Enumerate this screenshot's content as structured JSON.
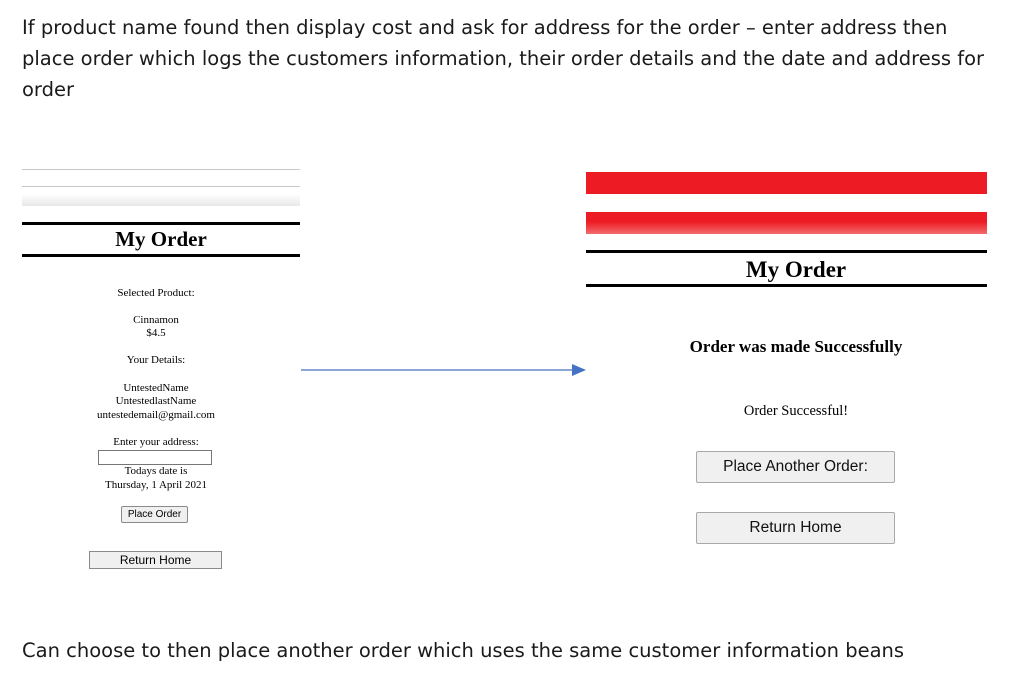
{
  "document": {
    "intro": "If product name found then display cost and ask for address for the order – enter address then place order which logs the customers information, their order details and the date and address for order",
    "outro": "Can choose to then place another order which uses the same customer information beans"
  },
  "left_page": {
    "title": "My Order",
    "selected_product_label": "Selected Product:",
    "product_name": "Cinnamon",
    "product_price": "$4.5",
    "your_details_label": "Your Details:",
    "first_name": "UntestedName",
    "last_name": "UntestedlastName",
    "email": "untestedemail@gmail.com",
    "address_label": "Enter your address:",
    "address_value": "",
    "date_label": "Todays date is",
    "date_value": "Thursday, 1 April 2021",
    "place_order_button": "Place Order",
    "return_home_button": "Return Home"
  },
  "right_page": {
    "title": "My Order",
    "heading": "Order was made Successfully",
    "message": "Order Successful!",
    "place_another_button": "Place Another Order:",
    "return_home_button": "Return Home"
  },
  "colors": {
    "header_red": "#ed1c24",
    "arrow_blue": "#4472c4"
  },
  "icons": {
    "flow_arrow": "right-arrow-icon"
  }
}
